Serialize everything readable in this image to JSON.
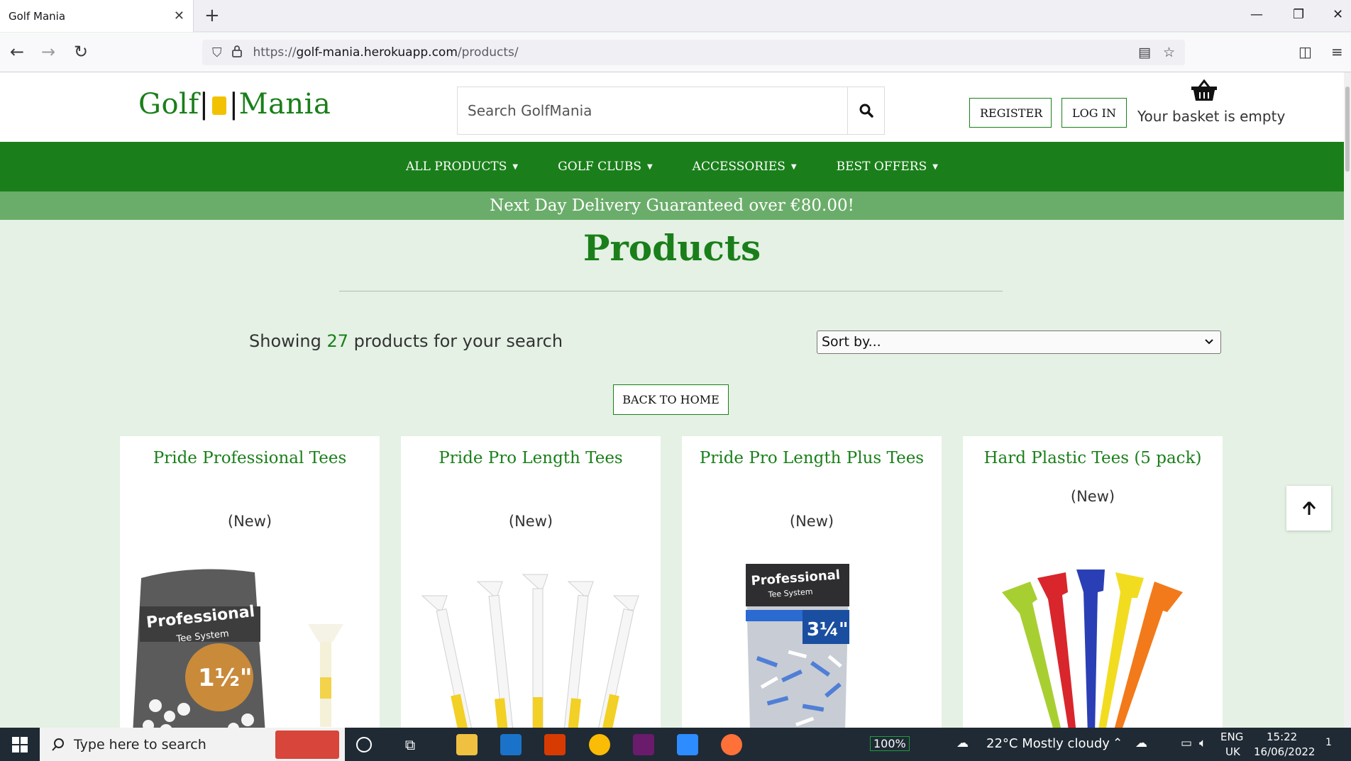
{
  "browser": {
    "tab_title": "Golf Mania",
    "url_prefix": "https://",
    "url_host": "golf-mania.herokuapp.com",
    "url_path": "/products/"
  },
  "header": {
    "logo_left": "Golf",
    "logo_right": "Mania",
    "search_placeholder": "Search GolfMania",
    "register_label": "REGISTER",
    "login_label": "LOG IN",
    "basket_text": "Your basket is empty"
  },
  "nav": {
    "items": [
      {
        "label": "ALL PRODUCTS"
      },
      {
        "label": "GOLF CLUBS"
      },
      {
        "label": "ACCESSORIES"
      },
      {
        "label": "BEST OFFERS"
      }
    ]
  },
  "banner": "Next Day Delivery Guaranteed over €80.00!",
  "main": {
    "title": "Products",
    "showing_prefix": "Showing ",
    "showing_count": "27",
    "showing_suffix": " products for your search",
    "sort_label": "Sort by...",
    "back_home_label": "BACK TO HOME"
  },
  "products": [
    {
      "name": "Pride Professional Tees",
      "badge": "(New)"
    },
    {
      "name": "Pride Pro Length Tees",
      "badge": "(New)"
    },
    {
      "name": "Pride Pro Length Plus Tees",
      "badge": "(New)"
    },
    {
      "name": "Hard Plastic Tees (5 pack)",
      "badge": "(New)"
    }
  ],
  "taskbar": {
    "search_placeholder": "Type here to search",
    "battery": "100%",
    "weather": "22°C  Mostly cloudy",
    "lang_top": "ENG",
    "lang_bottom": "UK",
    "time": "15:22",
    "date": "16/06/2022",
    "notifications": "1"
  },
  "colors": {
    "brand_green": "#1a7f1a",
    "banner_green": "#6aad6a",
    "page_bg": "#e4f1e4"
  }
}
